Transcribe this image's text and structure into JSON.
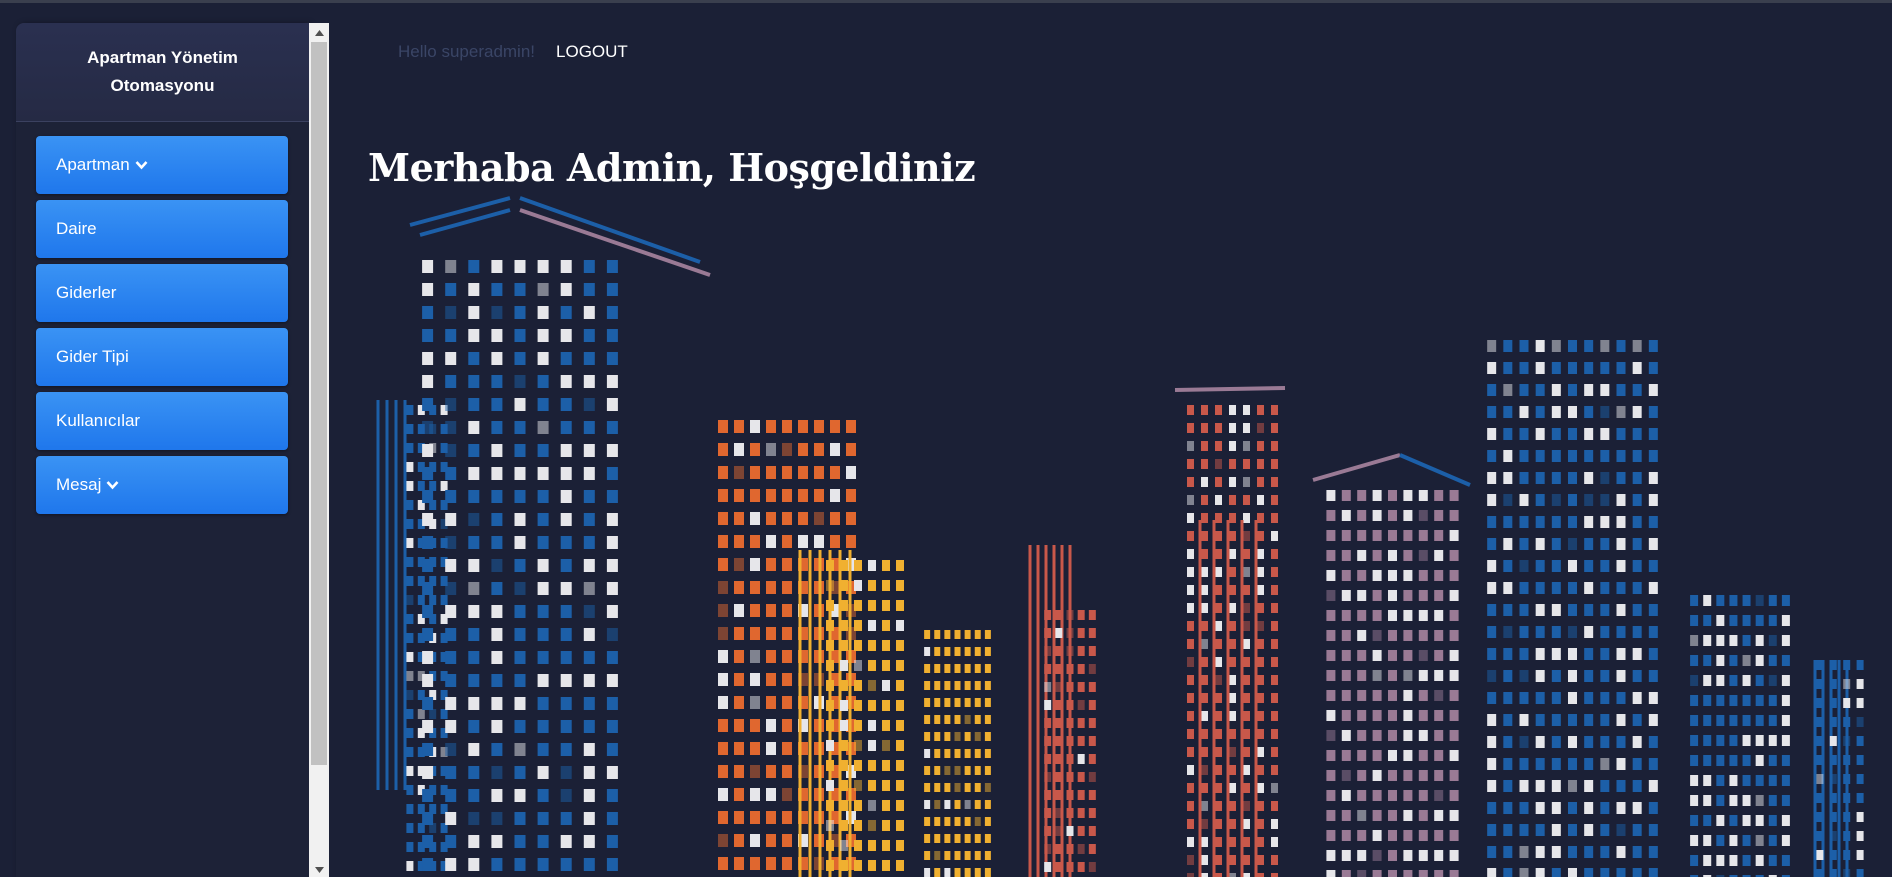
{
  "sidebar": {
    "brand": "Apartman Yönetim Otomasyonu",
    "items": [
      {
        "label": "Apartman",
        "dropdown": true
      },
      {
        "label": "Daire",
        "dropdown": false
      },
      {
        "label": "Giderler",
        "dropdown": false
      },
      {
        "label": "Gider Tipi",
        "dropdown": false
      },
      {
        "label": "Kullanıcılar",
        "dropdown": false
      },
      {
        "label": "Mesaj",
        "dropdown": true
      }
    ]
  },
  "topnav": {
    "greeting": "Hello superadmin!",
    "logout_label": "LOGOUT"
  },
  "main": {
    "welcome": "Merhaba Admin, Hoşgeldiniz"
  },
  "colors": {
    "background": "#1b2036",
    "menu_button": "#2a85f0",
    "building_blue": "#1c5fa8",
    "building_mauve": "#9a7a95",
    "building_orange": "#e0672f",
    "building_yellow": "#f0b030",
    "building_red": "#c9584a",
    "window_light": "#e6e6ea"
  },
  "icons": {
    "dropdown": "chevron-down-icon",
    "scroll_up": "triangle-up-icon",
    "scroll_down": "triangle-down-icon",
    "background_art": "city-skyline-illustration"
  }
}
